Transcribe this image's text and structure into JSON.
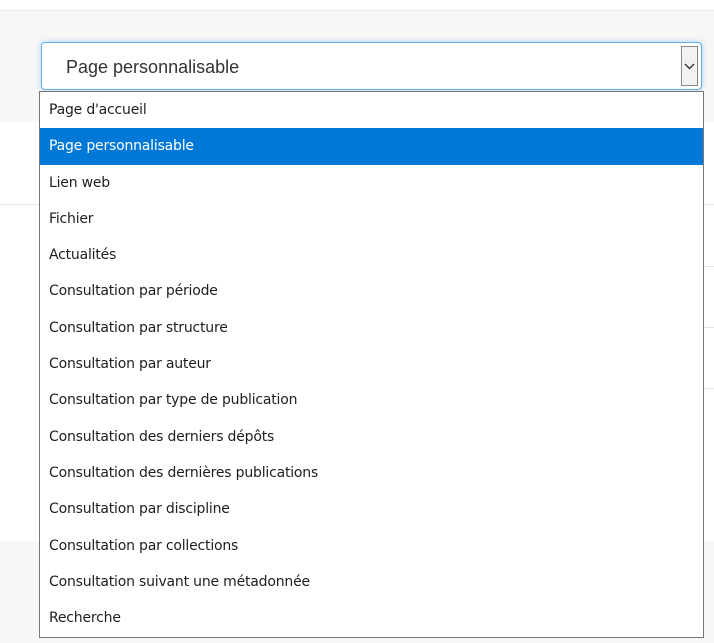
{
  "select": {
    "value": "Page personnalisable"
  },
  "dropdown": {
    "options": [
      {
        "label": "Page d'accueil",
        "selected": false
      },
      {
        "label": "Page personnalisable",
        "selected": true
      },
      {
        "label": "Lien web",
        "selected": false
      },
      {
        "label": "Fichier",
        "selected": false
      },
      {
        "label": "Actualités",
        "selected": false
      },
      {
        "label": "Consultation par période",
        "selected": false
      },
      {
        "label": "Consultation par structure",
        "selected": false
      },
      {
        "label": "Consultation par auteur",
        "selected": false
      },
      {
        "label": "Consultation par type de publication",
        "selected": false
      },
      {
        "label": "Consultation des derniers dépôts",
        "selected": false
      },
      {
        "label": "Consultation des dernières publications",
        "selected": false
      },
      {
        "label": "Consultation par discipline",
        "selected": false
      },
      {
        "label": "Consultation par collections",
        "selected": false
      },
      {
        "label": "Consultation suivant une métadonnée",
        "selected": false
      },
      {
        "label": "Recherche",
        "selected": false
      }
    ]
  },
  "colors": {
    "selected_bg": "#0078d7",
    "focus_border": "#66afe9"
  },
  "icons": {
    "arrow": "chevron-down-icon"
  }
}
